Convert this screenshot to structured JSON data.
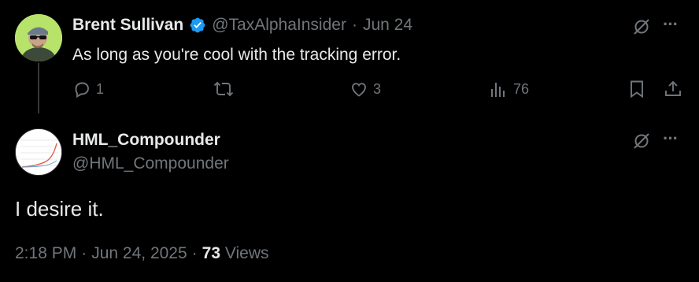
{
  "reply_tweet": {
    "author_name": "Brent Sullivan",
    "handle": "@TaxAlphaInsider",
    "separator": "·",
    "date": "Jun 24",
    "text": "As long as you're cool with the tracking error.",
    "actions": {
      "replies": "1",
      "retweets": "",
      "likes": "3",
      "views": "76"
    }
  },
  "main_tweet": {
    "author_name": "HML_Compounder",
    "handle": "@HML_Compounder",
    "text": "I desire it.",
    "time": "2:18 PM",
    "sep1": "·",
    "date": "Jun 24, 2025",
    "sep2": "·",
    "views_count": "73",
    "views_label": "Views"
  },
  "more_glyph": "···",
  "colors": {
    "background": "#000000",
    "text": "#e7e9ea",
    "muted": "#71767b",
    "verified": "#1d9bf0"
  }
}
